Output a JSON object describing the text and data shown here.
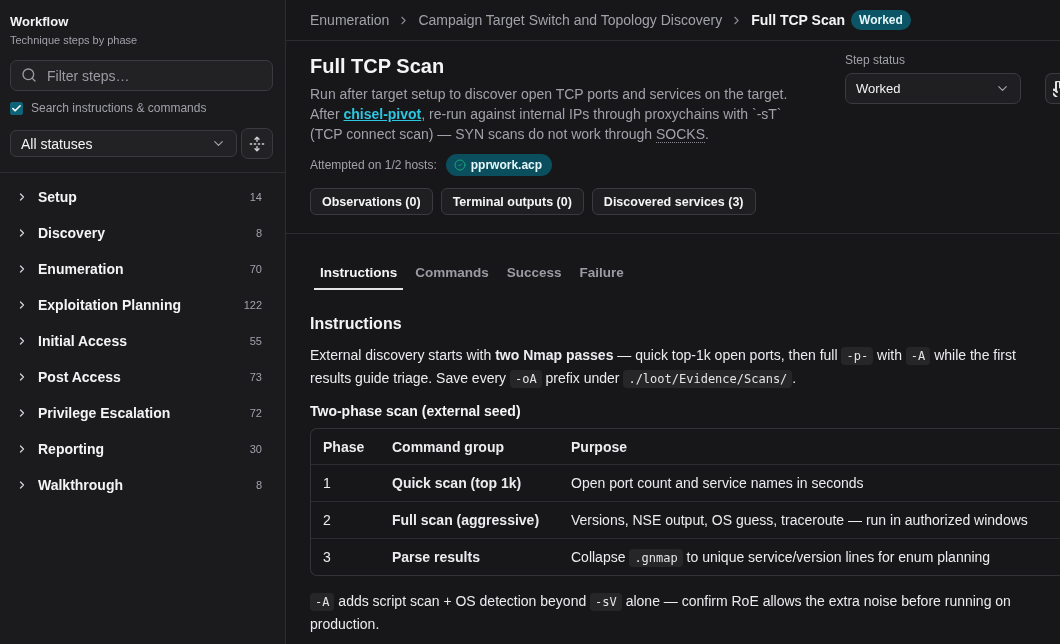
{
  "sidebar": {
    "title": "Workflow",
    "subtitle": "Technique steps by phase",
    "search": {
      "placeholder": "Filter steps…"
    },
    "search_scope": {
      "label": "Search instructions & commands",
      "checked": true
    },
    "status_filter": {
      "value": "All statuses"
    },
    "phases": [
      {
        "label": "Setup",
        "count": "14",
        "expanded": false
      },
      {
        "label": "Discovery",
        "count": "8",
        "expanded": false
      },
      {
        "label": "Enumeration",
        "count": "70",
        "expanded": false
      },
      {
        "label": "Exploitation Planning",
        "count": "122",
        "expanded": false
      },
      {
        "label": "Initial Access",
        "count": "55",
        "expanded": false
      },
      {
        "label": "Post Access",
        "count": "73",
        "expanded": false
      },
      {
        "label": "Privilege Escalation",
        "count": "72",
        "expanded": false
      },
      {
        "label": "Reporting",
        "count": "30",
        "expanded": false
      },
      {
        "label": "Walkthrough",
        "count": "8",
        "expanded": false
      }
    ]
  },
  "breadcrumb": {
    "items": [
      "Enumeration",
      "Campaign Target Switch and Topology Discovery"
    ],
    "current": "Full TCP Scan",
    "status_badge": "Worked"
  },
  "step": {
    "title": "Full TCP Scan",
    "description": [
      {
        "kind": "text",
        "text": "Run after target setup to discover open TCP ports and services on the target. After "
      },
      {
        "kind": "link",
        "text": "chisel-pivot"
      },
      {
        "kind": "text",
        "text": ", re-run against internal IPs through proxychains with `-sT` (TCP connect scan) — SYN scans do not work through "
      },
      {
        "kind": "abbr",
        "text": "SOCKS"
      },
      {
        "kind": "text",
        "text": "."
      }
    ],
    "attempted_label": "Attempted on 1/2 hosts:",
    "hosts": [
      {
        "name": "pprwork.acp"
      }
    ],
    "status": {
      "label": "Step status",
      "value": "Worked"
    },
    "actions": [
      "Observations (0)",
      "Terminal outputs (0)",
      "Discovered services (3)"
    ]
  },
  "tabs": [
    {
      "label": "Instructions",
      "selected": true
    },
    {
      "label": "Commands",
      "selected": false
    },
    {
      "label": "Success",
      "selected": false
    },
    {
      "label": "Failure",
      "selected": false
    }
  ],
  "content": {
    "heading": "Instructions",
    "intro": [
      {
        "kind": "text",
        "text": "External discovery starts with **two Nmap passes** — quick top-1k open ports, then full "
      },
      {
        "kind": "code",
        "text": "-p-"
      },
      {
        "kind": "text",
        "text": " with "
      },
      {
        "kind": "code",
        "text": "-A"
      },
      {
        "kind": "text",
        "text": " while the first results guide triage. Save every "
      },
      {
        "kind": "code",
        "text": "-oA"
      },
      {
        "kind": "text",
        "text": " prefix under "
      },
      {
        "kind": "code",
        "text": "./loot/Evidence/Scans/"
      },
      {
        "kind": "text",
        "text": "."
      }
    ],
    "table_title": "Two-phase scan (external seed)",
    "table": {
      "columns": [
        "Phase",
        "Command group",
        "Purpose"
      ],
      "rows": [
        {
          "phase": "1",
          "group": "Quick scan (top 1k)",
          "purpose": [
            {
              "kind": "text",
              "text": "Open port count and service names in seconds"
            }
          ]
        },
        {
          "phase": "2",
          "group": "Full scan (aggressive)",
          "purpose": [
            {
              "kind": "text",
              "text": "Versions, NSE output, OS guess, traceroute — run in authorized windows"
            }
          ]
        },
        {
          "phase": "3",
          "group": "Parse results",
          "purpose": [
            {
              "kind": "text",
              "text": "Collapse "
            },
            {
              "kind": "code",
              "text": ".gnmap"
            },
            {
              "kind": "text",
              "text": " to unique service/version lines for enum planning"
            }
          ]
        }
      ]
    },
    "note": [
      {
        "kind": "code",
        "text": "-A"
      },
      {
        "kind": "text",
        "text": " adds script scan + OS detection beyond "
      },
      {
        "kind": "code",
        "text": "-sV"
      },
      {
        "kind": "text",
        "text": " alone — confirm RoE allows the extra noise before running on production."
      }
    ]
  }
}
